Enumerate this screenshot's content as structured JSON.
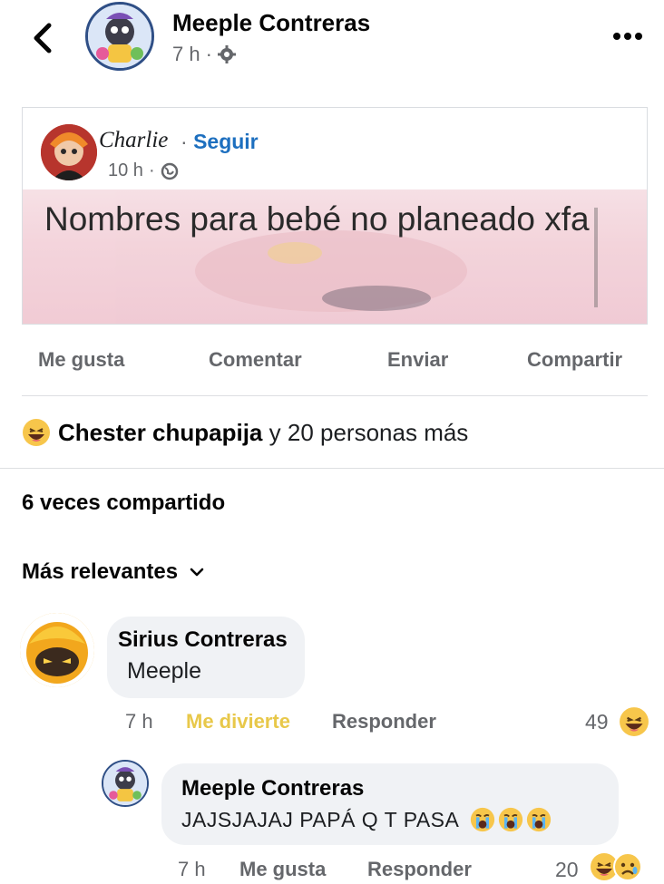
{
  "header": {
    "author": "Meeple Contreras",
    "time": "7 h",
    "separator": "·",
    "privacy_icon": "gear-icon",
    "back_icon": "chevron-left-icon",
    "more_icon": "more-horizontal-icon"
  },
  "shared_post": {
    "author": "Charlie",
    "separator": "·",
    "follow_label": "Seguir",
    "time": "10 h",
    "privacy_icon": "globe-icon",
    "text": "Nombres para bebé no planeado xfa"
  },
  "actions": {
    "like": "Me gusta",
    "comment": "Comentar",
    "send": "Enviar",
    "share": "Compartir"
  },
  "reactions": {
    "emoji": "laughing-face-icon",
    "name": "Chester chupapija",
    "others": "y 20 personas más"
  },
  "shares_text": "6 veces compartido",
  "sort": {
    "label": "Más relevantes",
    "icon": "chevron-down-icon"
  },
  "comments": [
    {
      "author": "Sirius Contreras",
      "text": "Meeple",
      "time": "7 h",
      "reaction_label": "Me divierte",
      "reply_label": "Responder",
      "count": "49",
      "reaction_icons": [
        "laughing-face-icon"
      ]
    },
    {
      "author": "Meeple Contreras",
      "text": "JAJSJAJAJ PAPÁ  Q T PASA",
      "time": "7 h",
      "like_label": "Me gusta",
      "reply_label": "Responder",
      "count": "20",
      "text_emojis": [
        "crying-face-icon",
        "crying-face-icon",
        "crying-face-icon"
      ],
      "reaction_icons": [
        "laughing-face-icon",
        "sad-face-icon"
      ]
    }
  ],
  "colors": {
    "link_blue": "#1d6fbf",
    "haha_yellow": "#e8c84a",
    "secondary_text": "#65676b",
    "bubble": "#f0f2f5"
  }
}
